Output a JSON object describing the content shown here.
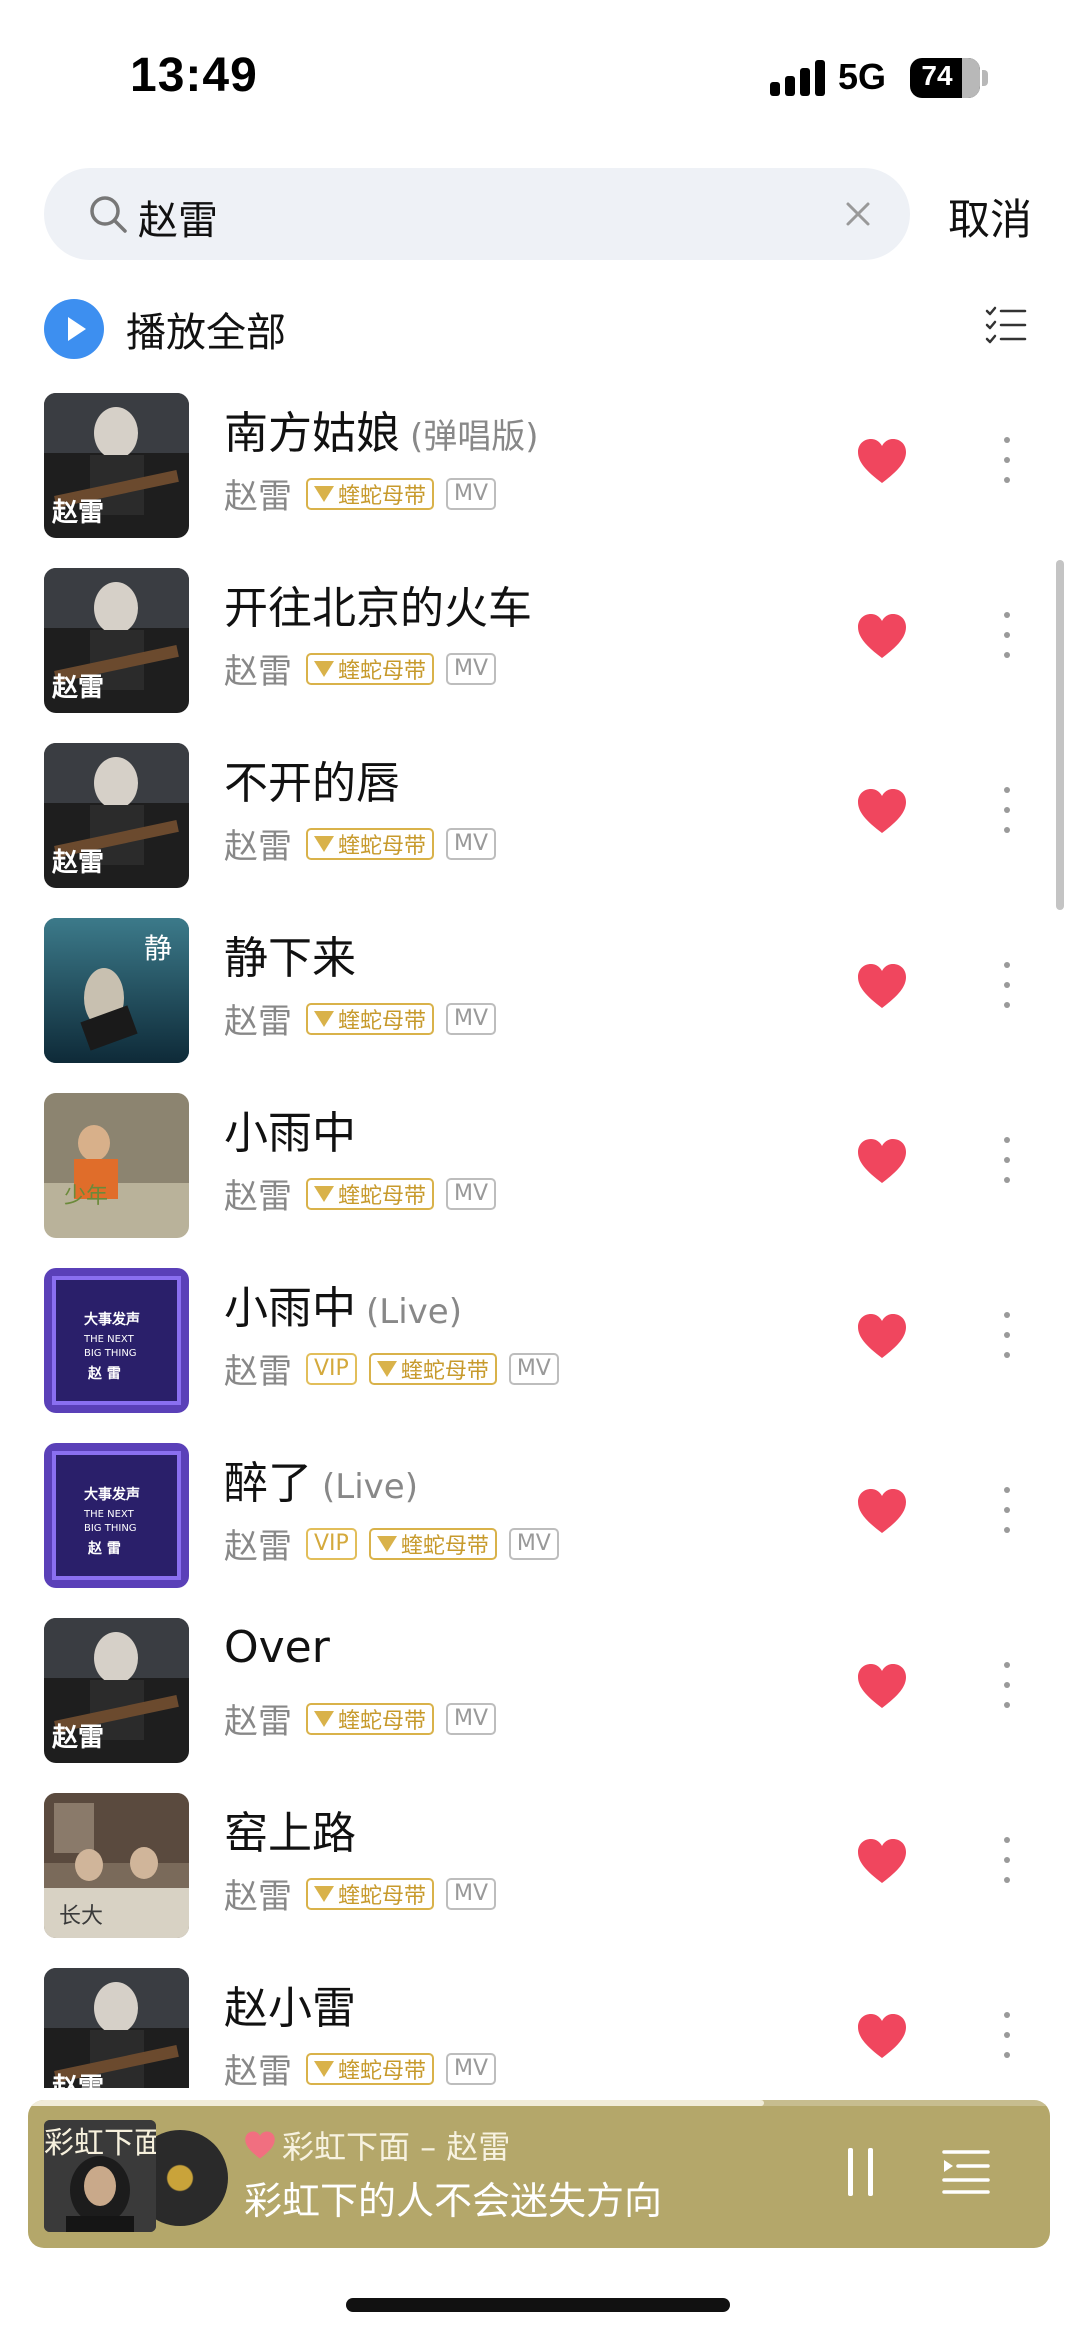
{
  "status_bar": {
    "time": "13:49",
    "network": "5G",
    "battery": "74"
  },
  "search": {
    "query": "赵雷",
    "cancel_label": "取消"
  },
  "play_all": {
    "label": "播放全部"
  },
  "songs": [
    {
      "title": "南方姑娘",
      "version": "(弹唱版)",
      "artist": "赵雷",
      "badges": [
        "snake",
        "mv"
      ],
      "badge_snake": "蝰蛇母带",
      "badge_mv": "MV",
      "cover_style": "dark-guitar"
    },
    {
      "title": "开往北京的火车",
      "version": "",
      "artist": "赵雷",
      "badges": [
        "snake",
        "mv"
      ],
      "badge_snake": "蝰蛇母带",
      "badge_mv": "MV",
      "cover_style": "dark-guitar"
    },
    {
      "title": "不开的唇",
      "version": "",
      "artist": "赵雷",
      "badges": [
        "snake",
        "mv"
      ],
      "badge_snake": "蝰蛇母带",
      "badge_mv": "MV",
      "cover_style": "dark-guitar"
    },
    {
      "title": "静下来",
      "version": "",
      "artist": "赵雷",
      "badges": [
        "snake",
        "mv"
      ],
      "badge_snake": "蝰蛇母带",
      "badge_mv": "MV",
      "cover_style": "blue-water"
    },
    {
      "title": "小雨中",
      "version": "",
      "artist": "赵雷",
      "badges": [
        "snake",
        "mv"
      ],
      "badge_snake": "蝰蛇母带",
      "badge_mv": "MV",
      "cover_style": "beige-portrait"
    },
    {
      "title": "小雨中",
      "version": "(Live)",
      "artist": "赵雷",
      "badges": [
        "vip",
        "snake",
        "mv"
      ],
      "badge_vip": "VIP",
      "badge_snake": "蝰蛇母带",
      "badge_mv": "MV",
      "cover_style": "purple-show"
    },
    {
      "title": "醉了",
      "version": "(Live)",
      "artist": "赵雷",
      "badges": [
        "vip",
        "snake",
        "mv"
      ],
      "badge_vip": "VIP",
      "badge_snake": "蝰蛇母带",
      "badge_mv": "MV",
      "cover_style": "purple-show"
    },
    {
      "title": "Over",
      "version": "",
      "artist": "赵雷",
      "badges": [
        "snake",
        "mv"
      ],
      "badge_snake": "蝰蛇母带",
      "badge_mv": "MV",
      "cover_style": "dark-guitar"
    },
    {
      "title": "窑上路",
      "version": "",
      "artist": "赵雷",
      "badges": [
        "snake",
        "mv"
      ],
      "badge_snake": "蝰蛇母带",
      "badge_mv": "MV",
      "cover_style": "room-photo"
    },
    {
      "title": "赵小雷",
      "version": "",
      "artist": "赵雷",
      "badges": [
        "snake",
        "mv"
      ],
      "badge_snake": "蝰蛇母带",
      "badge_mv": "MV",
      "cover_style": "dark-guitar"
    }
  ],
  "mini_player": {
    "cover_label": "彩虹下面",
    "now_playing": "彩虹下面 – 赵雷",
    "lyric": "彩虹下的人不会迷失方向",
    "progress": 0.72
  },
  "colors": {
    "accent_blue": "#3d8ff0",
    "heart_red": "#f0465e",
    "badge_gold": "#d9b24a",
    "player_bg": "#b4a76a"
  }
}
